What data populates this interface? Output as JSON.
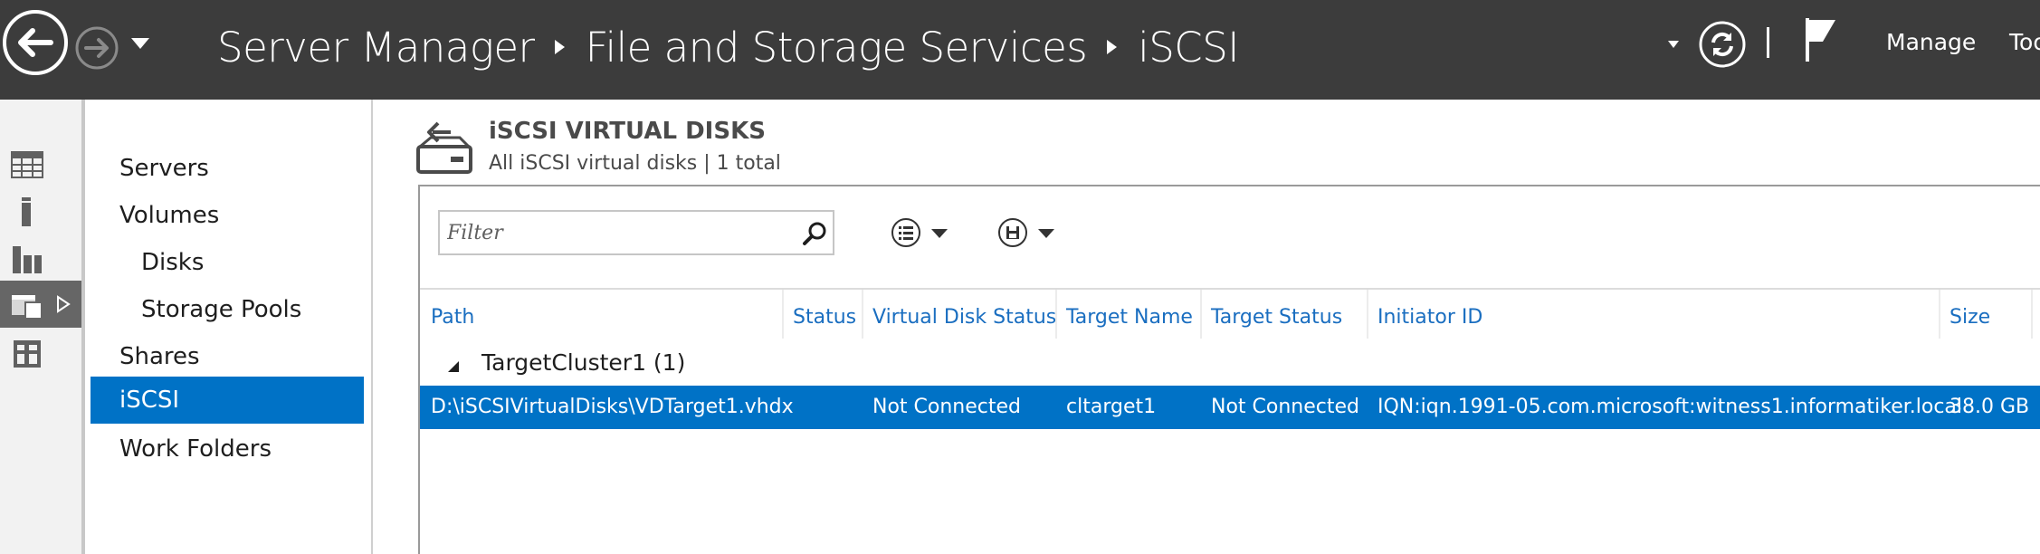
{
  "titlebar": {
    "breadcrumbs": [
      {
        "label": "Server Manager"
      },
      {
        "label": "File and Storage Services"
      },
      {
        "label": "iSCSI"
      }
    ],
    "menu_manage": "Manage",
    "menu_tools": "Too",
    "icons": {
      "back": "back-arrow-icon",
      "forward": "forward-arrow-icon",
      "refresh": "refresh-icon",
      "flag": "notifications-flag-icon"
    }
  },
  "rail": {
    "items": [
      {
        "icon": "dashboard-icon"
      },
      {
        "icon": "local-server-icon"
      },
      {
        "icon": "all-servers-icon"
      },
      {
        "icon": "file-storage-services-icon",
        "active": true
      },
      {
        "icon": "iis-icon"
      }
    ]
  },
  "nav": {
    "items": [
      {
        "label": "Servers"
      },
      {
        "label": "Volumes"
      },
      {
        "label": "Disks"
      },
      {
        "label": "Storage Pools"
      },
      {
        "label": "Shares"
      },
      {
        "label": "iSCSI"
      },
      {
        "label": "Work Folders"
      }
    ]
  },
  "main": {
    "title": "iSCSI VIRTUAL DISKS",
    "subtitle": "All iSCSI virtual disks | 1 total",
    "filter_placeholder": "Filter",
    "columns": [
      "Path",
      "Status",
      "Virtual Disk Status",
      "Target Name",
      "Target Status",
      "Initiator ID",
      "Size"
    ],
    "group_label": "TargetCluster1 (1)",
    "rows": [
      {
        "path": "D:\\iSCSIVirtualDisks\\VDTarget1.vhdx",
        "status": "",
        "virtual_disk_status": "Not Connected",
        "target_name": "cltarget1",
        "target_status": "Not Connected",
        "initiator_id": "IQN:iqn.1991-05.com.microsoft:witness1.informatiker.local",
        "size": "38.0 GB"
      }
    ]
  },
  "colors": {
    "titlebar_bg": "#3c3c3c",
    "accent_selected": "#0072c6",
    "header_text": "#1a6ec0",
    "rail_bg": "#f2f2f2",
    "rail_active": "#666666"
  }
}
